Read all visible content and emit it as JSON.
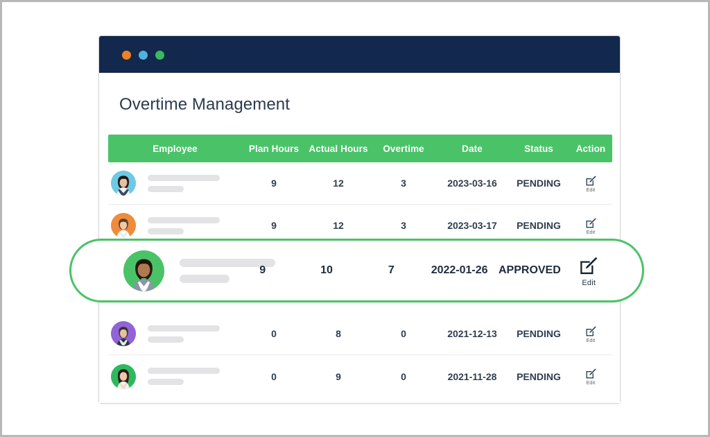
{
  "window": {
    "dots": [
      {
        "name": "close",
        "color": "#f08024"
      },
      {
        "name": "minimize",
        "color": "#4fb3de"
      },
      {
        "name": "maximize",
        "color": "#38ba5f"
      }
    ],
    "titlebar_color": "#12284c"
  },
  "page": {
    "title": "Overtime Management",
    "accent_color": "#4ac368",
    "text_color": "#2e3d50"
  },
  "table": {
    "columns": [
      {
        "key": "employee",
        "label": "Employee"
      },
      {
        "key": "plan_hours",
        "label": "Plan Hours"
      },
      {
        "key": "actual_hours",
        "label": "Actual Hours"
      },
      {
        "key": "overtime",
        "label": "Overtime"
      },
      {
        "key": "date",
        "label": "Date"
      },
      {
        "key": "status",
        "label": "Status"
      },
      {
        "key": "action",
        "label": "Action"
      }
    ],
    "rows": [
      {
        "employee": "",
        "avatar": "avatar-woman-dark-hair",
        "avatar_bg": "#6ecae4",
        "plan_hours": "9",
        "actual_hours": "12",
        "overtime": "3",
        "date": "2023-03-16",
        "status": "PENDING",
        "action_label": "Edit",
        "action_icon": "edit-pencil-icon",
        "selected": false
      },
      {
        "employee": "",
        "avatar": "avatar-man-short-hair",
        "avatar_bg": "#ef8c3c",
        "plan_hours": "9",
        "actual_hours": "12",
        "overtime": "3",
        "date": "2023-03-17",
        "status": "PENDING",
        "action_label": "Edit",
        "action_icon": "edit-pencil-icon",
        "selected": false
      },
      {
        "employee": "",
        "avatar": "avatar-man-beard",
        "avatar_bg": "#4ac368",
        "plan_hours": "9",
        "actual_hours": "10",
        "overtime": "7",
        "date": "2022-01-26",
        "status": "APPROVED",
        "action_label": "Edit",
        "action_icon": "edit-pencil-icon",
        "selected": true
      },
      {
        "employee": "",
        "avatar": "avatar-man-glasses",
        "avatar_bg": "#9063d8",
        "plan_hours": "0",
        "actual_hours": "8",
        "overtime": "0",
        "date": "2021-12-13",
        "status": "PENDING",
        "action_label": "Edit",
        "action_icon": "edit-pencil-icon",
        "selected": false
      },
      {
        "employee": "",
        "avatar": "avatar-woman-long-hair",
        "avatar_bg": "#2fb85e",
        "plan_hours": "0",
        "actual_hours": "9",
        "overtime": "0",
        "date": "2021-11-28",
        "status": "PENDING",
        "action_label": "Edit",
        "action_icon": "edit-pencil-icon",
        "selected": false
      }
    ]
  }
}
